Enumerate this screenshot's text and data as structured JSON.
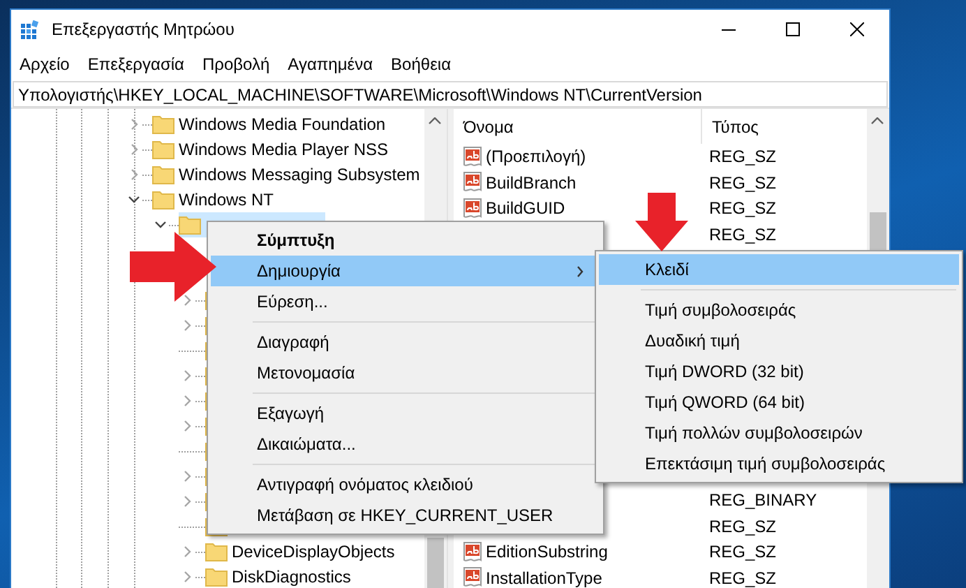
{
  "window": {
    "title": "Επεξεργαστής Μητρώου"
  },
  "menu_bar": [
    "Αρχείο",
    "Επεξεργασία",
    "Προβολή",
    "Αγαπημένα",
    "Βοήθεια"
  ],
  "address_bar": {
    "value": "Υπολογιστής\\HKEY_LOCAL_MACHINE\\SOFTWARE\\Microsoft\\Windows NT\\CurrentVersion"
  },
  "tree": [
    {
      "label": "Windows Media Foundation",
      "expandable": true,
      "expanded": false
    },
    {
      "label": "Windows Media Player NSS",
      "expandable": true,
      "expanded": false
    },
    {
      "label": "Windows Messaging Subsystem",
      "expandable": true,
      "expanded": false
    },
    {
      "label": "Windows NT",
      "expandable": true,
      "expanded": true,
      "children": [
        {
          "selected": true,
          "expandable": true,
          "expanded": true,
          "children": [
            {
              "expandable": true,
              "expanded": false
            },
            {
              "expandable": true,
              "expanded": false
            },
            {
              "expandable": false
            },
            {
              "expandable": true,
              "expanded": false
            },
            {
              "expandable": true,
              "expanded": false
            },
            {
              "expandable": true,
              "expanded": false
            },
            {
              "expandable": false
            },
            {
              "expandable": true,
              "expanded": false
            },
            {
              "expandable": true,
              "expanded": false
            },
            {
              "expandable": false
            },
            {
              "label": "DeviceDisplayObjects",
              "expandable": true,
              "expanded": false
            },
            {
              "label": "DiskDiagnostics",
              "expandable": true,
              "expanded": false
            }
          ]
        }
      ]
    }
  ],
  "values_list": {
    "columns": [
      "Όνομα",
      "Τύπος"
    ],
    "rows": [
      {
        "kind": "string",
        "name": "(Προεπιλογή)",
        "type": "REG_SZ"
      },
      {
        "kind": "string",
        "name": "BuildBranch",
        "type": "REG_SZ"
      },
      {
        "kind": "string",
        "name": "BuildGUID",
        "type": "REG_SZ"
      },
      {
        "type": "REG_SZ"
      }
    ],
    "rows_lower": [
      {
        "type": "REG_BINARY"
      },
      {
        "type": "REG_SZ"
      },
      {
        "kind": "string",
        "name": "EditionSubstring",
        "type": "REG_SZ"
      },
      {
        "kind": "string",
        "name": "InstallationType",
        "type": "REG_SZ"
      }
    ]
  },
  "context_menu": [
    {
      "kind": "item",
      "label": "Σύμπτυξη",
      "bold": true,
      "selected": false,
      "has_submenu": false
    },
    {
      "kind": "item",
      "label": "Δημιουργία",
      "bold": false,
      "selected": true,
      "has_submenu": true
    },
    {
      "kind": "item",
      "label": "Εύρεση...",
      "bold": false,
      "selected": false,
      "has_submenu": false
    },
    {
      "kind": "separator"
    },
    {
      "kind": "item",
      "label": "Διαγραφή",
      "bold": false,
      "selected": false,
      "has_submenu": false
    },
    {
      "kind": "item",
      "label": "Μετονομασία",
      "bold": false,
      "selected": false,
      "has_submenu": false
    },
    {
      "kind": "separator"
    },
    {
      "kind": "item",
      "label": "Εξαγωγή",
      "bold": false,
      "selected": false,
      "has_submenu": false
    },
    {
      "kind": "item",
      "label": "Δικαιώματα...",
      "bold": false,
      "selected": false,
      "has_submenu": false
    },
    {
      "kind": "separator"
    },
    {
      "kind": "item",
      "label": "Αντιγραφή ονόματος κλειδιού",
      "bold": false,
      "selected": false,
      "has_submenu": false
    },
    {
      "kind": "item",
      "label": "Μετάβαση σε HKEY_CURRENT_USER",
      "bold": false,
      "selected": false,
      "has_submenu": false
    }
  ],
  "submenu": [
    {
      "kind": "item",
      "label": "Κλειδί",
      "bold": false,
      "selected": true,
      "has_submenu": false
    },
    {
      "kind": "separator"
    },
    {
      "kind": "item",
      "label": "Τιμή συμβολοσειράς",
      "bold": false,
      "selected": false,
      "has_submenu": false
    },
    {
      "kind": "item",
      "label": "Δυαδική τιμή",
      "bold": false,
      "selected": false,
      "has_submenu": false
    },
    {
      "kind": "item",
      "label": "Τιμή DWORD (32 bit)",
      "bold": false,
      "selected": false,
      "has_submenu": false
    },
    {
      "kind": "item",
      "label": "Τιμή QWORD (64 bit)",
      "bold": false,
      "selected": false,
      "has_submenu": false
    },
    {
      "kind": "item",
      "label": "Τιμή πολλών συμβολοσειρών",
      "bold": false,
      "selected": false,
      "has_submenu": false
    },
    {
      "kind": "item",
      "label": "Επεκτάσιμη τιμή συμβολοσειράς",
      "bold": false,
      "selected": false,
      "has_submenu": false
    }
  ],
  "annotations": [
    {
      "kind": "arrow"
    },
    {
      "kind": "arrow"
    }
  ]
}
